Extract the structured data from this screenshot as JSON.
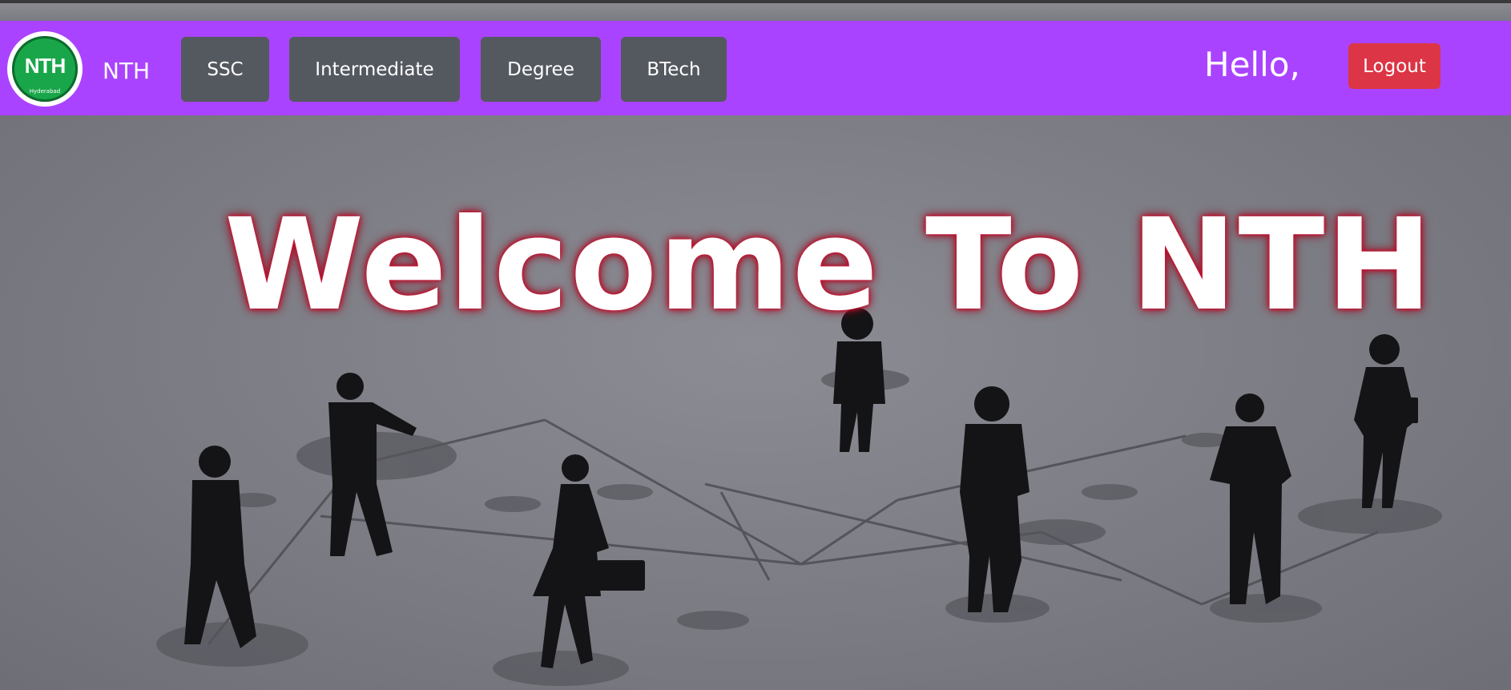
{
  "brand": {
    "logo_text": "NTH",
    "logo_ring_text": "Hyderabad",
    "name": "NTH"
  },
  "nav": {
    "items": [
      {
        "label": "SSC"
      },
      {
        "label": "Intermediate"
      },
      {
        "label": "Degree"
      },
      {
        "label": "BTech"
      }
    ]
  },
  "user": {
    "greeting": "Hello,",
    "logout_label": "Logout"
  },
  "hero": {
    "title": "Welcome To NTH"
  },
  "colors": {
    "navbar": "#aa43ff",
    "nav_button": "#545960",
    "logout": "#dc3545",
    "title_glow": "#c8102e"
  }
}
